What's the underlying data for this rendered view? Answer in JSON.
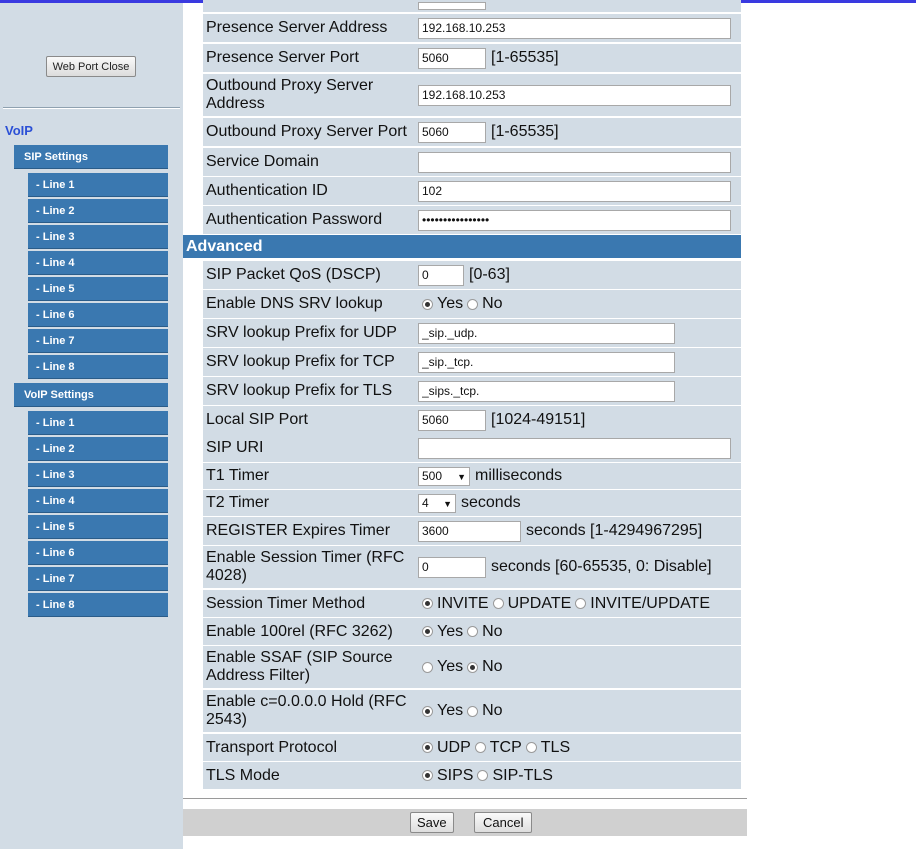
{
  "sidebar": {
    "web_port_close": "Web Port Close",
    "voip_label": "VoIP",
    "sip_settings": "SIP Settings",
    "sip_lines": [
      "- Line 1",
      "- Line 2",
      "- Line 3",
      "- Line 4",
      "- Line 5",
      "- Line 6",
      "- Line 7",
      "- Line 8"
    ],
    "voip_settings": "VoIP Settings",
    "voip_lines": [
      "- Line 1",
      "- Line 2",
      "- Line 3",
      "- Line 4",
      "- Line 5",
      "- Line 6",
      "- Line 7",
      "- Line 8"
    ]
  },
  "form": {
    "presence_server_address": {
      "label": "Presence Server Address",
      "value": "192.168.10.253"
    },
    "presence_server_port": {
      "label": "Presence Server Port",
      "value": "5060",
      "range": "[1-65535]"
    },
    "outbound_proxy_address": {
      "label": "Outbound Proxy Server Address",
      "value": "192.168.10.253"
    },
    "outbound_proxy_port": {
      "label": "Outbound Proxy Server Port",
      "value": "5060",
      "range": "[1-65535]"
    },
    "service_domain": {
      "label": "Service Domain",
      "value": ""
    },
    "authentication_id": {
      "label": "Authentication ID",
      "value": "102"
    },
    "authentication_password": {
      "label": "Authentication Password",
      "value": "••••••••••••••••"
    },
    "advanced_title": "Advanced",
    "sip_qos": {
      "label": "SIP Packet QoS (DSCP)",
      "value": "0",
      "range": "[0-63]"
    },
    "dns_srv": {
      "label": "Enable DNS SRV lookup",
      "opt_yes": "Yes",
      "opt_no": "No",
      "selected": "Yes"
    },
    "srv_udp": {
      "label": "SRV lookup Prefix for UDP",
      "value": "_sip._udp."
    },
    "srv_tcp": {
      "label": "SRV lookup Prefix for TCP",
      "value": "_sip._tcp."
    },
    "srv_tls": {
      "label": "SRV lookup Prefix for TLS",
      "value": "_sips._tcp."
    },
    "local_sip_port": {
      "label": "Local SIP Port",
      "value": "5060",
      "range": "[1024-49151]"
    },
    "sip_uri": {
      "label": "SIP URI",
      "value": ""
    },
    "t1_timer": {
      "label": "T1 Timer",
      "value": "500",
      "unit": "milliseconds"
    },
    "t2_timer": {
      "label": "T2 Timer",
      "value": "4",
      "unit": "seconds"
    },
    "register_expires": {
      "label": "REGISTER Expires Timer",
      "value": "3600",
      "unit": "seconds [1-4294967295]"
    },
    "session_timer": {
      "label": "Enable Session Timer (RFC 4028)",
      "value": "0",
      "unit": "seconds [60-65535, 0: Disable]"
    },
    "session_timer_method": {
      "label": "Session Timer Method",
      "opt_invite": "INVITE",
      "opt_update": "UPDATE",
      "opt_both": "INVITE/UPDATE",
      "selected": "INVITE"
    },
    "rel100": {
      "label": "Enable 100rel (RFC 3262)",
      "opt_yes": "Yes",
      "opt_no": "No",
      "selected": "Yes"
    },
    "ssaf": {
      "label": "Enable SSAF (SIP Source Address Filter)",
      "opt_yes": "Yes",
      "opt_no": "No",
      "selected": "No"
    },
    "hold": {
      "label": "Enable c=0.0.0.0 Hold (RFC 2543)",
      "opt_yes": "Yes",
      "opt_no": "No",
      "selected": "Yes"
    },
    "transport": {
      "label": "Transport Protocol",
      "opt_udp": "UDP",
      "opt_tcp": "TCP",
      "opt_tls": "TLS",
      "selected": "UDP"
    },
    "tls_mode": {
      "label": "TLS Mode",
      "opt_sips": "SIPS",
      "opt_siptls": "SIP-TLS",
      "selected": "SIPS"
    }
  },
  "buttons": {
    "save": "Save",
    "cancel": "Cancel"
  },
  "colors": {
    "nav_blue": "#3a78b0",
    "row_bg": "#d2dce5",
    "voip_label": "#2b50d6"
  }
}
